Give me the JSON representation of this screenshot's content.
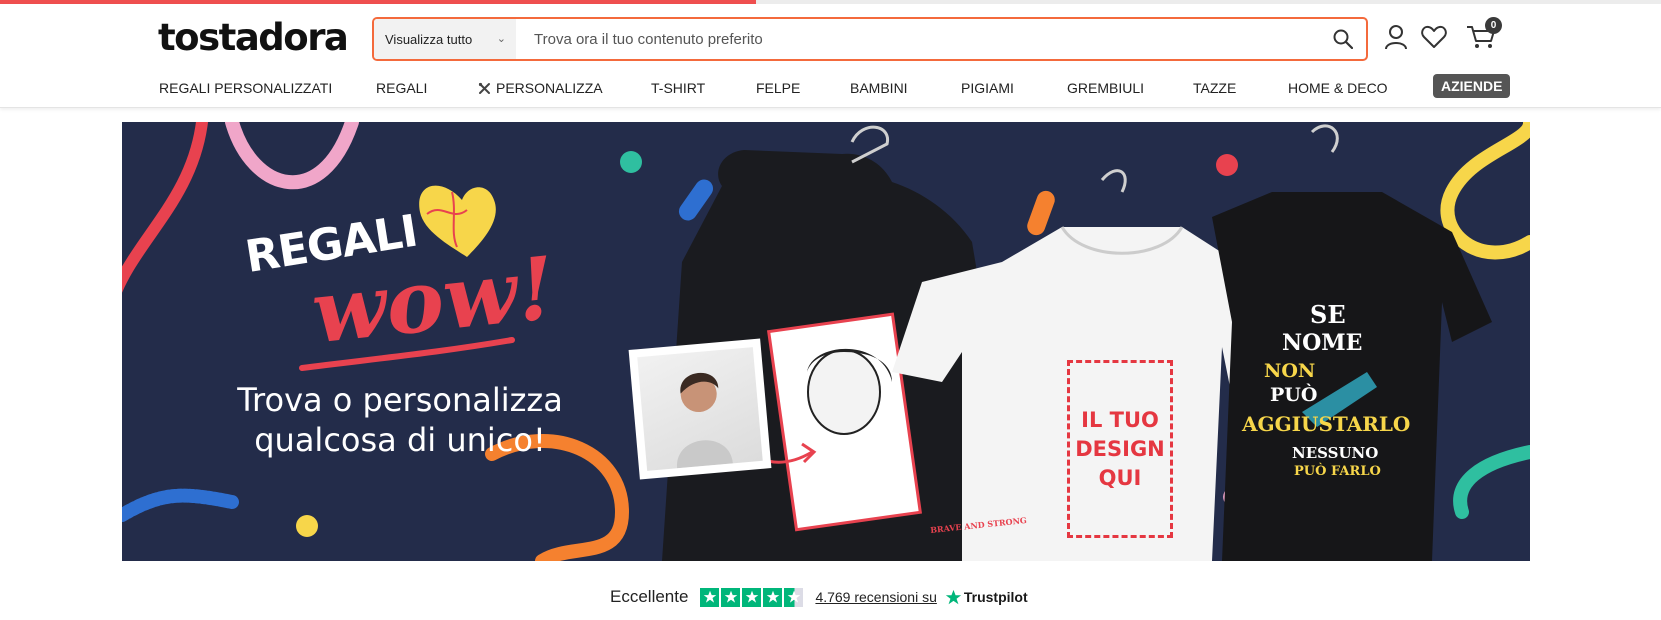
{
  "page": {
    "load_progress": 0.455
  },
  "brand": {
    "logo_text": "tostadora"
  },
  "search": {
    "category_selected": "Visualizza tutto",
    "placeholder": "Trova ora il tuo contenuto preferito"
  },
  "header_icons": {
    "account": "user-icon",
    "wishlist": "heart-icon",
    "cart": "cart-icon",
    "cart_count": "0"
  },
  "nav": {
    "items": [
      {
        "label": "REGALI PERSONALIZZATI"
      },
      {
        "label": "REGALI"
      },
      {
        "label": "PERSONALIZZA",
        "icon": "tools-icon"
      },
      {
        "label": "T-SHIRT"
      },
      {
        "label": "FELPE"
      },
      {
        "label": "BAMBINI"
      },
      {
        "label": "PIGIAMI"
      },
      {
        "label": "GREMBIULI"
      },
      {
        "label": "TAZZE"
      },
      {
        "label": "HOME & DECO"
      }
    ],
    "badge": "AZIENDE"
  },
  "banner": {
    "headline_top": "REGALI",
    "headline_script": "wow!",
    "subtitle_line1": "Trova o personalizza",
    "subtitle_line2": "qualcosa di unico!",
    "tee_design_line1": "IL TUO",
    "tee_design_line2": "DESIGN",
    "tee_design_line3": "QUI",
    "hoodie_print_caption": "BRAVE AND STRONG",
    "black_tee_lines": [
      "SE",
      "NOME",
      "NON",
      "PUÒ",
      "AGGIUSTARLO",
      "NESSUNO",
      "PUÒ FARLO"
    ],
    "colors": {
      "background": "#232c4a",
      "accent_red": "#e8424f",
      "accent_orange": "#f5812f",
      "accent_yellow": "#f7d64a"
    }
  },
  "trust": {
    "rating_label": "Eccellente",
    "stars": 4.5,
    "reviews_text": "4.769 recensioni su",
    "provider": "Trustpilot"
  }
}
